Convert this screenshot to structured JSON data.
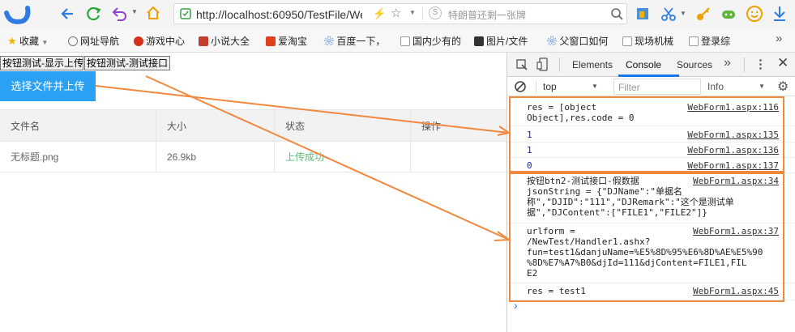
{
  "browser": {
    "url": "http://localhost:60950/TestFile/We",
    "search_hint": "特朗普还剩一张牌"
  },
  "bookmarks": [
    {
      "label": "收藏",
      "color": "#f0b400"
    },
    {
      "label": "网址导航",
      "color": "#888888"
    },
    {
      "label": "游戏中心",
      "color": "#d9301c"
    },
    {
      "label": "小说大全",
      "color": "#c23e2e"
    },
    {
      "label": "爱淘宝",
      "color": "#e0401e"
    },
    {
      "label": "百度一下，",
      "color": "#2b6fd6"
    },
    {
      "label": "国内少有的",
      "color": "#bbbbbb"
    },
    {
      "label": "图片/文件",
      "color": "#333333"
    },
    {
      "label": "父窗口如何",
      "color": "#2b6fd6"
    },
    {
      "label": "现场机械",
      "color": "#bbbbbb"
    },
    {
      "label": "登录综",
      "color": "#bbbbbb"
    }
  ],
  "page": {
    "btn1": "按钮测试-显示上传",
    "btn2": "按钮测试-测试接口",
    "upload_button": "选择文件并上传",
    "table": {
      "headers": [
        "文件名",
        "大小",
        "状态",
        "操作"
      ],
      "row": {
        "name": "无标题.png",
        "size": "26.9kb",
        "status": "上传成功",
        "op": ""
      }
    }
  },
  "devtools": {
    "tabs": [
      "Elements",
      "Console",
      "Sources"
    ],
    "context": "top",
    "filter_placeholder": "Filter",
    "level": "Info",
    "logs": [
      {
        "text": "res = [object Object],res.code = 0",
        "src": "WebForm1.aspx:116",
        "lines": [
          "res = [object",
          "Object],res.code = 0"
        ]
      },
      {
        "text": "1",
        "src": "WebForm1.aspx:135"
      },
      {
        "text": "1",
        "src": "WebForm1.aspx:136"
      },
      {
        "text": "0",
        "src": "WebForm1.aspx:137"
      },
      {
        "src": "WebForm1.aspx:34",
        "lines": [
          "按钮btn2-测试接口-假数据",
          "jsonString = {\"DJName\":\"单据名",
          "称\",\"DJID\":\"111\",\"DJRemark\":\"这个是测试单",
          "据\",\"DJContent\":[\"FILE1\",\"FILE2\"]}"
        ]
      },
      {
        "src": "WebForm1.aspx:37",
        "lines": [
          "urlform =",
          "/NewTest/Handler1.ashx?",
          "fun=test1&danjuName=%E5%8D%95%E6%8D%AE%E5%90",
          "%8D%E7%A7%B0&djId=111&djContent=FILE1,FIL",
          "E2"
        ]
      },
      {
        "src": "WebForm1.aspx:45",
        "lines": [
          "res = test1"
        ]
      }
    ],
    "prompt": "›"
  },
  "colors": {
    "accent": "#2aa1f3",
    "highlight": "#f0883e",
    "success": "#5fb878"
  }
}
